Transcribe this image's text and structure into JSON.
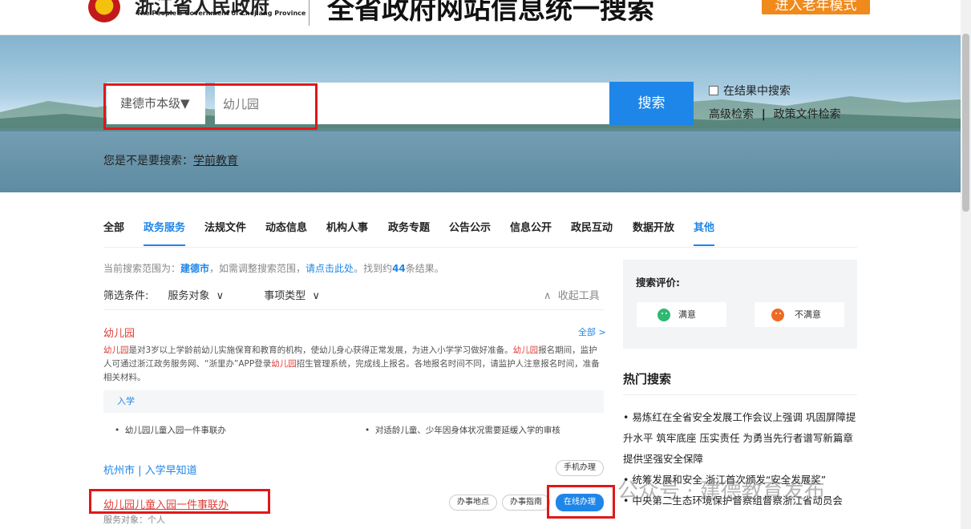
{
  "header": {
    "brand_cn": "浙江省人民政府",
    "brand_en": "The People's Government of Zhejiang Province",
    "site_title": "全省政府网站信息统一搜索",
    "elder_mode": "进入老年模式"
  },
  "search": {
    "scope": "建德市本级▼",
    "query": "幼儿园",
    "button": "搜索",
    "in_results": "在结果中搜索",
    "advanced": "高级检索",
    "policy": "政策文件检索",
    "suggest_prefix": "您是不是要搜索：",
    "suggest_term": "学前教育"
  },
  "tabs": [
    "全部",
    "政务服务",
    "法规文件",
    "动态信息",
    "机构人事",
    "政务专题",
    "公告公示",
    "信息公开",
    "政民互动",
    "数据开放",
    "其他"
  ],
  "scope_line": {
    "prefix": "当前搜索范围为：",
    "city": "建德市",
    "mid": "，如需调整搜索范围，",
    "link": "请点击此处",
    "found": "。找到约",
    "count": "44",
    "suffix": "条结果。"
  },
  "filters": {
    "label": "筛选条件:",
    "service_target": "服务对象",
    "item_type": "事项类型",
    "collapse": "收起工具"
  },
  "result1": {
    "title": "幼儿园",
    "all": "全部 >",
    "desc_1": "幼儿园",
    "desc_2": "是对3岁以上学龄前幼儿实施保育和教育的机构，使幼儿身心获得正常发展，为进入小学学习做好准备。",
    "desc_3": "幼儿园",
    "desc_4": "报名期间，监护人可通过浙江政务服务网、“浙里办”APP登录",
    "desc_5": "幼儿园",
    "desc_6": "招生管理系统，完成线上报名。各地报名时间不同，请监护人注意报名时间，准备相关材料。",
    "box": "入学",
    "item1": "幼儿园儿童入园一件事联办",
    "item2": "对适龄儿童、少年因身体状况需要延缓入学的审核"
  },
  "result2": {
    "title": "杭州市 | 入学早知道",
    "mobile": "手机办理"
  },
  "result3": {
    "title": "幼儿园儿童入园一件事联办",
    "sub": "服务对象：个人",
    "addr": "办事地点",
    "guide": "办事指南",
    "online": "在线办理"
  },
  "evaluation": {
    "title": "搜索评价:",
    "good": "满意",
    "bad": "不满意"
  },
  "hot": {
    "title": "热门搜索",
    "items": [
      "• 易炼红在全省安全发展工作会议上强调 巩固屏障提升水平 筑牢底座 压实责任 为勇当先行者谱写新篇章提供坚强安全保障",
      "• 统筹发展和安全 浙江首次颁发“安全发展奖”",
      "• 中央第二生态环境保护督察组督察浙江省动员会"
    ]
  },
  "watermark": "公众号 · 建德教育发布",
  "colors": {
    "accent": "#1e86e8",
    "highlight_red": "#e01818",
    "elder_orange": "#f08a1c"
  }
}
